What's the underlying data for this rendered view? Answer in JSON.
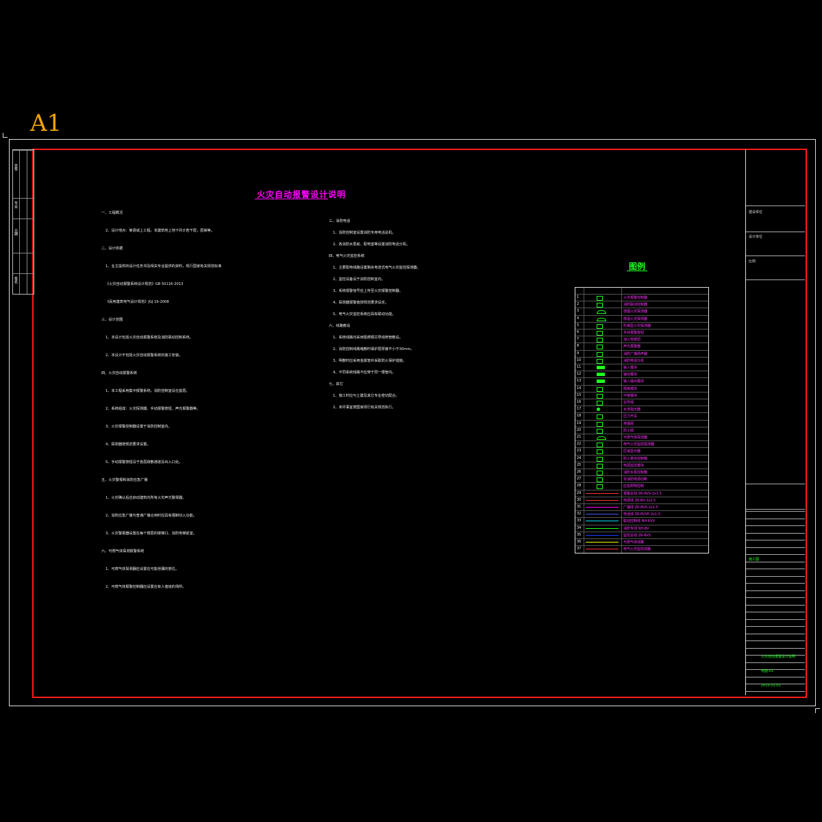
{
  "sheet_label": "A1",
  "main_title": "火灾自动报警设计说明",
  "legend_title": "图例",
  "left_strip_labels": [
    "会签",
    "专业",
    "日期",
    "签名"
  ],
  "title_block": {
    "project": "建设单位",
    "design": "设计单位",
    "drawing_name": "火灾自动报警设计说明",
    "drawing_no": "电施-01",
    "date": "2015.01.01",
    "stage": "施工图",
    "scale": "比例"
  },
  "col1_lines": [
    "一、工程概况",
    "2、设计地点：某县城上工程，本建筑地上地下共计若干层，层高等。",
    "二、设计依据",
    "1、业主提供的设计任务书及相关专业提供的资料，现行国家有关规范标准",
    "  《火灾自动报警系统设计规范》GB 50116-2013",
    "  《民用建筑电气设计规范》JGJ 16-2008",
    "三、设计范围",
    "1、本设计包括火灾自动报警系统及消防联动控制系统。",
    "2、本设计不包括火灾自动报警系统的施工安装。",
    "四、火灾自动报警系统",
    "1、本工程采用集中报警系统，消防控制室设在首层。",
    "2、系统组成：火灾探测器、手动报警按钮、声光报警器等。",
    "3、火灾报警控制器设置于消防控制室内。",
    "4、探测器按规范要求设置。",
    "5、手动报警按钮设于各层疏散通道及出入口处。",
    "五、火灾警报和消防应急广播",
    "1、火灾确认后应启动建筑内所有火灾声光警报器。",
    "2、消防应急广播与普通广播合用时应具有强制切入功能。",
    "3、火灾警报器设置在每个楼层的楼梯口、消防电梯前室。",
    "六、可燃气体探测报警系统",
    "1、可燃气体探测器应设置在可能泄漏的部位。",
    "2、可燃气体报警控制器应设置在有人值班的场所。"
  ],
  "col2_lines": [
    "三、消防电话",
    "1、消防控制室设置消防专用电话总机。",
    "2、各消防水泵房、配电室等设置消防电话分机。",
    "四、电气火灾监控系统",
    "1、主要配电线路设置剩余电流式电气火灾监控探测器。",
    "2、监控设备设于消防控制室内。",
    "3、系统报警信号应上传至火灾报警控制器。",
    "4、探测器报警值按规范要求设定。",
    "5、电气火灾监控系统应具有联动功能。",
    "六、线路敷设",
    "1、系统线路均采用阻燃铜芯导线穿管敷设。",
    "2、消防控制线路暗敷时保护层厚度不小于30mm。",
    "3、明敷时应采用金属管并采取防火保护措施。",
    "4、不同系统线路不应穿于同一根管内。",
    "七、其它",
    "1、施工时应与土建及其它专业密切配合。",
    "2、未尽事宜按国家现行有关规范执行。"
  ],
  "legend_rows": [
    {
      "num": "1",
      "sym": "box",
      "color": "#20ff20",
      "desc": "火灾报警控制器"
    },
    {
      "num": "2",
      "sym": "boxx",
      "color": "#20ff20",
      "desc": "消防联动控制器"
    },
    {
      "num": "3",
      "sym": "dome",
      "color": "#20ff20",
      "desc": "感烟火灾探测器"
    },
    {
      "num": "4",
      "sym": "dome",
      "color": "#20ff20",
      "desc": "感温火灾探测器"
    },
    {
      "num": "5",
      "sym": "boxx",
      "color": "#20ff20",
      "desc": "防爆型火灾探测器"
    },
    {
      "num": "6",
      "sym": "box",
      "color": "#20ff20",
      "desc": "手动报警按钮"
    },
    {
      "num": "7",
      "sym": "box",
      "color": "#20ff20",
      "desc": "消火栓按钮"
    },
    {
      "num": "8",
      "sym": "boxs",
      "color": "#20ff20",
      "desc": "声光报警器"
    },
    {
      "num": "9",
      "sym": "boxs",
      "color": "#20ff20",
      "desc": "消防广播扬声器"
    },
    {
      "num": "10",
      "sym": "boxs",
      "color": "#20ff20",
      "desc": "消防电话分机"
    },
    {
      "num": "11",
      "sym": "fill",
      "color": "#20ff20",
      "desc": "输入模块"
    },
    {
      "num": "12",
      "sym": "fill",
      "color": "#20ff20",
      "desc": "输出模块"
    },
    {
      "num": "13",
      "sym": "fill",
      "color": "#20ff20",
      "desc": "输入输出模块"
    },
    {
      "num": "14",
      "sym": "box",
      "color": "#20ff20",
      "desc": "隔离模块"
    },
    {
      "num": "15",
      "sym": "box",
      "color": "#20ff20",
      "desc": "中继模块"
    },
    {
      "num": "16",
      "sym": "box",
      "color": "#20ff20",
      "desc": "信号阀"
    },
    {
      "num": "17",
      "sym": "circle",
      "color": "#20ff20",
      "desc": "水流指示器"
    },
    {
      "num": "18",
      "sym": "box",
      "color": "#20ff20",
      "desc": "压力开关"
    },
    {
      "num": "19",
      "sym": "box",
      "color": "#20ff20",
      "desc": "排烟阀"
    },
    {
      "num": "20",
      "sym": "box",
      "color": "#20ff20",
      "desc": "防火阀"
    },
    {
      "num": "21",
      "sym": "dome",
      "color": "#20ff20",
      "desc": "可燃气体探测器"
    },
    {
      "num": "22",
      "sym": "box",
      "color": "#20ff20",
      "desc": "电气火灾监控探测器"
    },
    {
      "num": "23",
      "sym": "box",
      "color": "#20ff20",
      "desc": "区域显示器"
    },
    {
      "num": "24",
      "sym": "boxx",
      "color": "#20ff20",
      "desc": "防火卷帘控制箱"
    },
    {
      "num": "25",
      "sym": "box",
      "color": "#20ff20",
      "desc": "电源监控模块"
    },
    {
      "num": "26",
      "sym": "box",
      "color": "#20ff20",
      "desc": "消防水泵控制箱"
    },
    {
      "num": "27",
      "sym": "boxx",
      "color": "#20ff20",
      "desc": "非消防电源切断"
    },
    {
      "num": "28",
      "sym": "box",
      "color": "#20ff20",
      "desc": "应急照明控制"
    },
    {
      "num": "29",
      "sym": "line",
      "color": "#ff3333",
      "desc": "报警总线 ZR-RVS-2x1.5"
    },
    {
      "num": "30",
      "sym": "line",
      "color": "#ff3333",
      "desc": "电源线 ZR-BV-2x2.5"
    },
    {
      "num": "31",
      "sym": "line",
      "color": "#ff00ff",
      "desc": "广播线 ZR-RVS-2x1.5"
    },
    {
      "num": "32",
      "sym": "line",
      "color": "#4060ff",
      "desc": "电话线 ZR-RVVP-2x1.0"
    },
    {
      "num": "33",
      "sym": "line",
      "color": "#00e0ff",
      "desc": "联动控制线 NH-KVV"
    },
    {
      "num": "34",
      "sym": "line",
      "color": "#20ff20",
      "desc": "消防专线 NH-BV"
    },
    {
      "num": "35",
      "sym": "line",
      "color": "#2040ff",
      "desc": "监控总线 ZR-RVS"
    },
    {
      "num": "36",
      "sym": "line",
      "color": "#ffff00",
      "desc": "可燃气体线路"
    },
    {
      "num": "37",
      "sym": "line",
      "color": "#ff3333",
      "desc": "电气火灾监控线路"
    }
  ]
}
